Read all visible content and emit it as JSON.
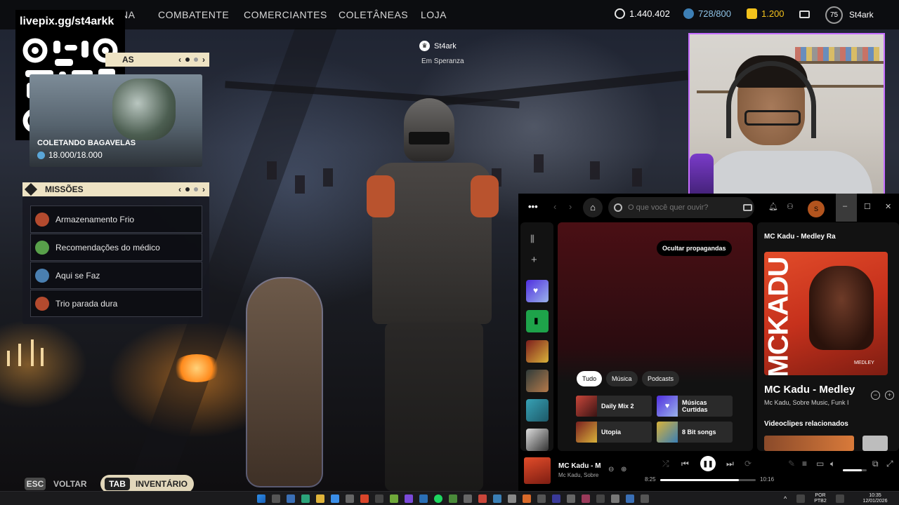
{
  "game": {
    "nav": {
      "partial_item": "NA",
      "items": [
        "COMBATENTE",
        "COMERCIANTES",
        "COLETÂNEAS",
        "LOJA"
      ]
    },
    "currencies": [
      {
        "icon": "coin-icon",
        "value": "1.440.402",
        "color": "#e8e8e8"
      },
      {
        "icon": "credits-icon",
        "value": "728/800",
        "color": "#8fc3e6"
      },
      {
        "icon": "raider-token-icon",
        "value": "1.200",
        "color": "#f3c21c"
      }
    ],
    "mail_icon": "mail-icon",
    "level": "75",
    "username": "St4ark",
    "overlay_url": "livepix.gg/st4arkk",
    "collect_panel": {
      "header_partial": "AS",
      "title": "COLETANDO BAGAVELAS",
      "value": "18.000/18.000"
    },
    "missions": {
      "header": "MISSÕES",
      "items": [
        {
          "label": "Armazenamento Frio",
          "color": "#b34a2e"
        },
        {
          "label": "Recomendações do médico",
          "color": "#58a04a"
        },
        {
          "label": "Aqui se Faz",
          "color": "#4a7fb0"
        },
        {
          "label": "Trio parada dura",
          "color": "#b34a2e"
        }
      ]
    },
    "player_tag": {
      "name": "St4ark",
      "location": "Em Speranza"
    },
    "keys": {
      "esc_key": "ESC",
      "esc_label": "VOLTAR",
      "tab_key": "TAB",
      "tab_label": "INVENTÁRIO"
    }
  },
  "spotify": {
    "menu_icon": "•••",
    "search_placeholder": "O que você quer ouvir?",
    "avatar_letter": "S",
    "ad_button": "Ocultar propagandas",
    "chips": [
      "Tudo",
      "Música",
      "Podcasts"
    ],
    "cards": [
      {
        "label": "Daily Mix 2",
        "color": "#c9463a"
      },
      {
        "label": "Músicas Curtidas",
        "color": "#7b5cf0"
      },
      {
        "label": "Utopia",
        "color": "#7a1f1f"
      },
      {
        "label": "8 Bit songs",
        "color": "#d9b23a"
      }
    ],
    "now_playing": {
      "panel_title": "MC Kadu - Medley Ra",
      "art_text": "MCKADU",
      "art_subtext": "MEDLEY",
      "title": "MC Kadu - Medley",
      "artists": "Mc Kadu, Sobre Music, Funk I",
      "related_header": "Videoclipes relacionados"
    },
    "player_bar": {
      "title": "MC Kadu - Me",
      "artist": "Mc Kadu, Sobre",
      "current_time": "8:25",
      "total_time": "10:16",
      "progress": 0.82,
      "volume": 0.8
    }
  },
  "taskbar": {
    "lang": "POR",
    "layout": "PTB2",
    "time": "10:35",
    "date": "12/01/2026"
  }
}
